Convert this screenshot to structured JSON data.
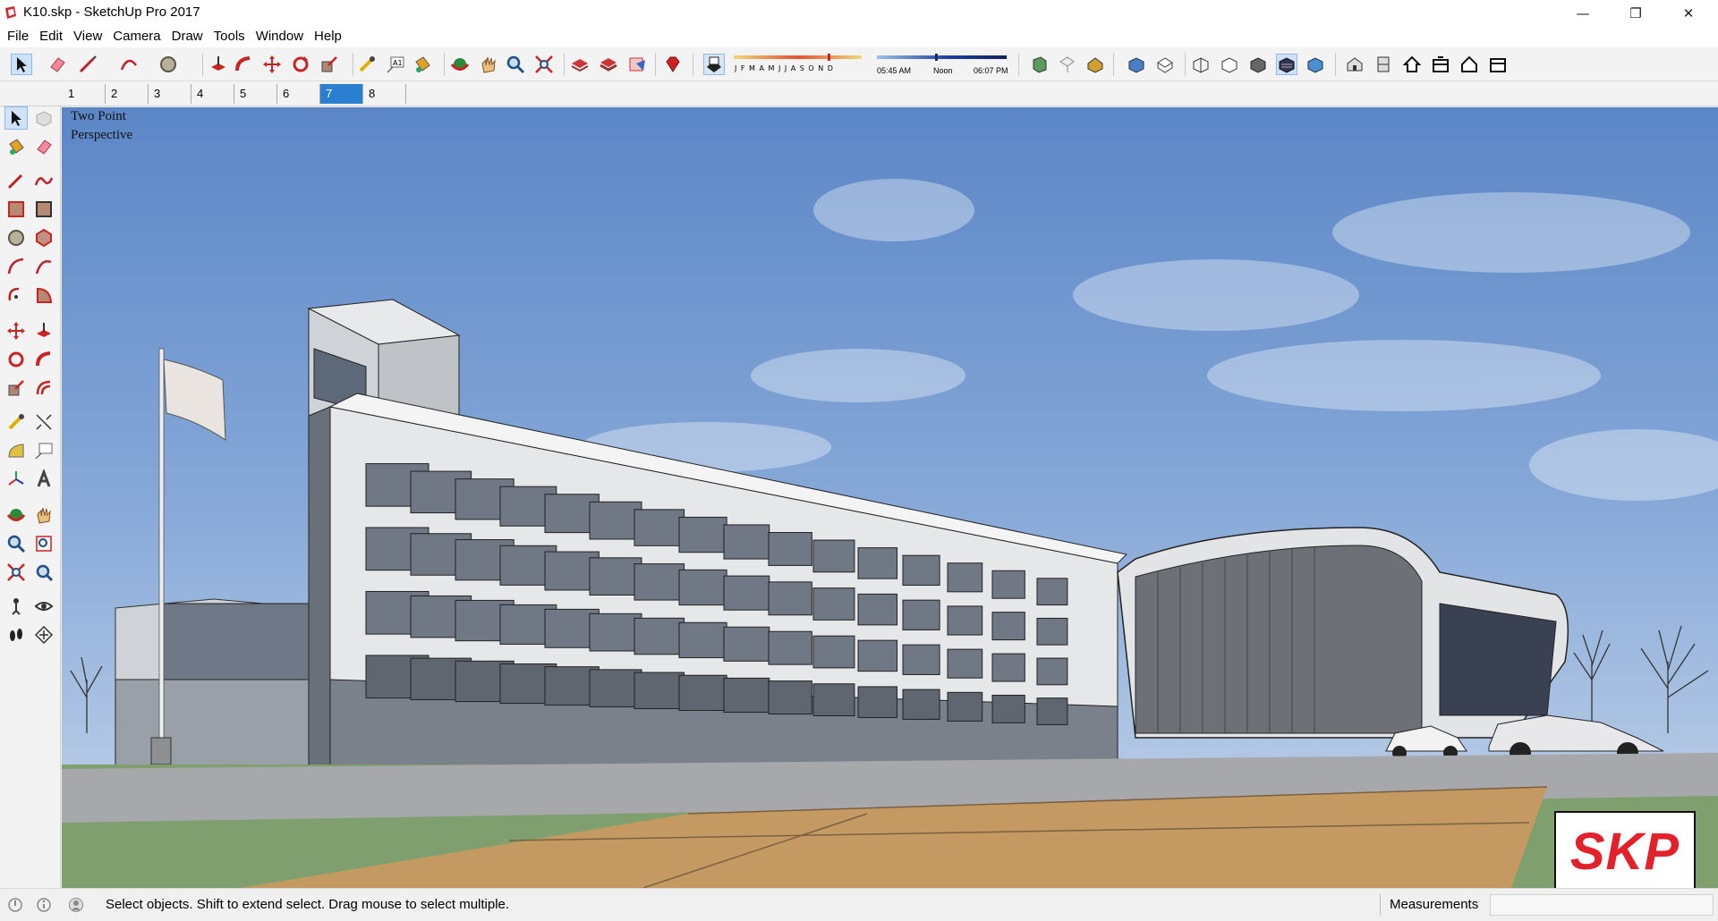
{
  "window": {
    "title": "K10.skp - SketchUp Pro 2017",
    "minimize_glyph": "—",
    "maximize_glyph": "❐",
    "close_glyph": "✕"
  },
  "menu": [
    "File",
    "Edit",
    "View",
    "Camera",
    "Draw",
    "Tools",
    "Window",
    "Help"
  ],
  "shadow_widget": {
    "months": "J F M A M J J A S O N D",
    "time_start": "05:45 AM",
    "time_noon": "Noon",
    "time_end": "06:07 PM"
  },
  "scenes": {
    "tabs": [
      "1",
      "2",
      "3",
      "4",
      "5",
      "6",
      "7",
      "8"
    ],
    "active": "7"
  },
  "viewport": {
    "view_label": "Two Point\nPerspective",
    "logo_text": "SKP"
  },
  "status": {
    "message": "Select objects. Shift to extend select. Drag mouse to select multiple.",
    "measurements_label": "Measurements",
    "measurements_value": ""
  },
  "colors": {
    "accent": "#2a7fd0",
    "logo_red": "#e3212b",
    "sky": "#6e97d0"
  },
  "icons": {
    "toolbar": [
      "select-icon",
      "eraser-icon",
      "line-icon",
      "arc-icon",
      "circle-icon",
      "pushpull-icon",
      "followme-icon",
      "move-icon",
      "rotate-icon",
      "scale-icon",
      "tape-icon",
      "text-icon",
      "paint-icon",
      "orbit-icon",
      "pan-icon",
      "zoom-icon",
      "zoom-extents-icon",
      "warehouse-icon",
      "extension-warehouse-icon",
      "layout-icon",
      "ruby-icon",
      "shadows-toggle-icon",
      "xray-icon",
      "backedges-icon",
      "wireframe-icon",
      "hiddenline-icon",
      "shaded-icon",
      "textured-icon",
      "monochrome-icon",
      "iso-view-icon",
      "top-view-icon",
      "front-view-icon",
      "right-view-icon",
      "back-view-icon",
      "left-view-icon"
    ],
    "left": [
      "select-icon",
      "component-icon",
      "paint-icon",
      "eraser-icon",
      "line-icon",
      "freehand-icon",
      "rectangle-icon",
      "rotated-rect-icon",
      "circle-icon",
      "polygon-icon",
      "arc-icon",
      "two-point-arc-icon",
      "pie-icon",
      "three-point-arc-icon",
      "move-icon",
      "pushpull-icon",
      "rotate-icon",
      "followme-icon",
      "scale-icon",
      "offset-icon",
      "tape-icon",
      "dimension-icon",
      "protractor-icon",
      "text-icon",
      "axes-icon",
      "3d-text-icon",
      "orbit-icon",
      "pan-icon",
      "zoom-icon",
      "zoom-window-icon",
      "zoom-extents-icon",
      "previous-view-icon",
      "position-camera-icon",
      "look-around-icon",
      "walk-icon",
      "section-plane-icon"
    ]
  }
}
